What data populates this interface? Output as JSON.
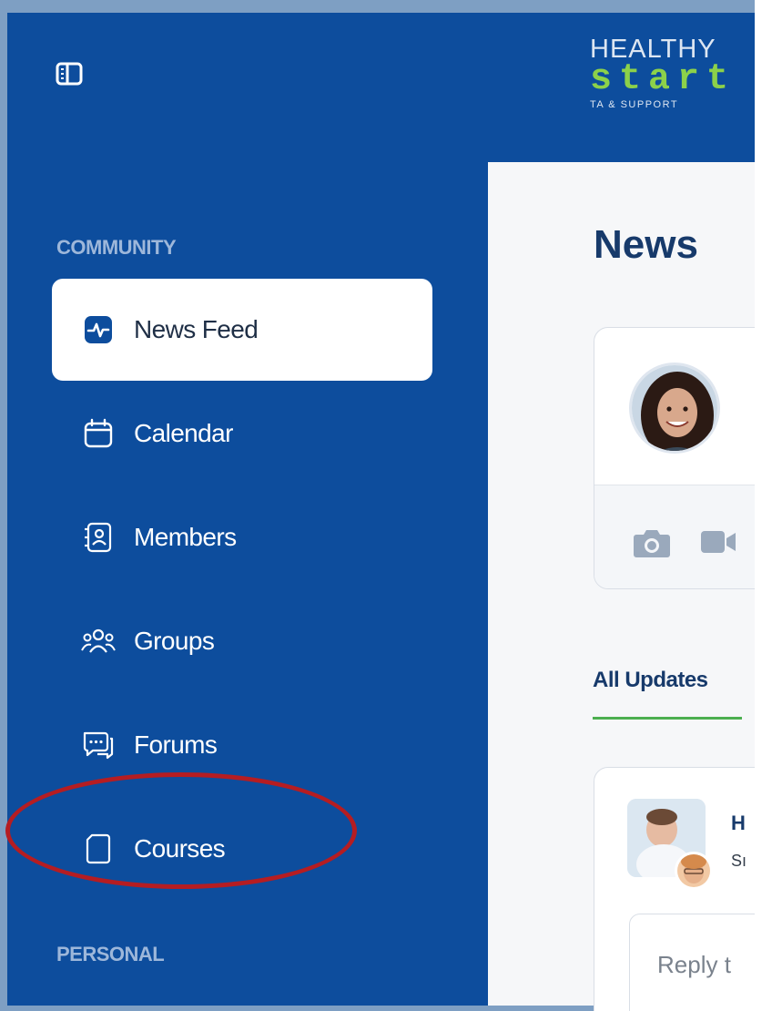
{
  "logo": {
    "line1": "HEALTHY",
    "line2": "start",
    "line3": "TA & SUPPORT"
  },
  "sidebar": {
    "toggle_icon": "sidebar-toggle-icon",
    "sections": [
      {
        "label": "COMMUNITY",
        "items": [
          {
            "label": "News Feed",
            "icon": "activity-icon",
            "active": true
          },
          {
            "label": "Calendar",
            "icon": "calendar-icon",
            "active": false
          },
          {
            "label": "Members",
            "icon": "members-icon",
            "active": false
          },
          {
            "label": "Groups",
            "icon": "groups-icon",
            "active": false
          },
          {
            "label": "Forums",
            "icon": "forums-icon",
            "active": false
          },
          {
            "label": "Courses",
            "icon": "courses-icon",
            "active": false
          }
        ]
      },
      {
        "label": "PERSONAL",
        "items": []
      }
    ]
  },
  "main": {
    "page_title": "News",
    "tabs": [
      {
        "label": "All Updates",
        "active": true
      }
    ],
    "post": {
      "name": "H",
      "sub": "Sı"
    },
    "reply_placeholder": "Reply t"
  },
  "colors": {
    "sidebar_bg": "#0d4d9d",
    "logo_green": "#8cd14a",
    "tab_underline": "#4caf50",
    "annotation_circle": "#b51d22"
  }
}
